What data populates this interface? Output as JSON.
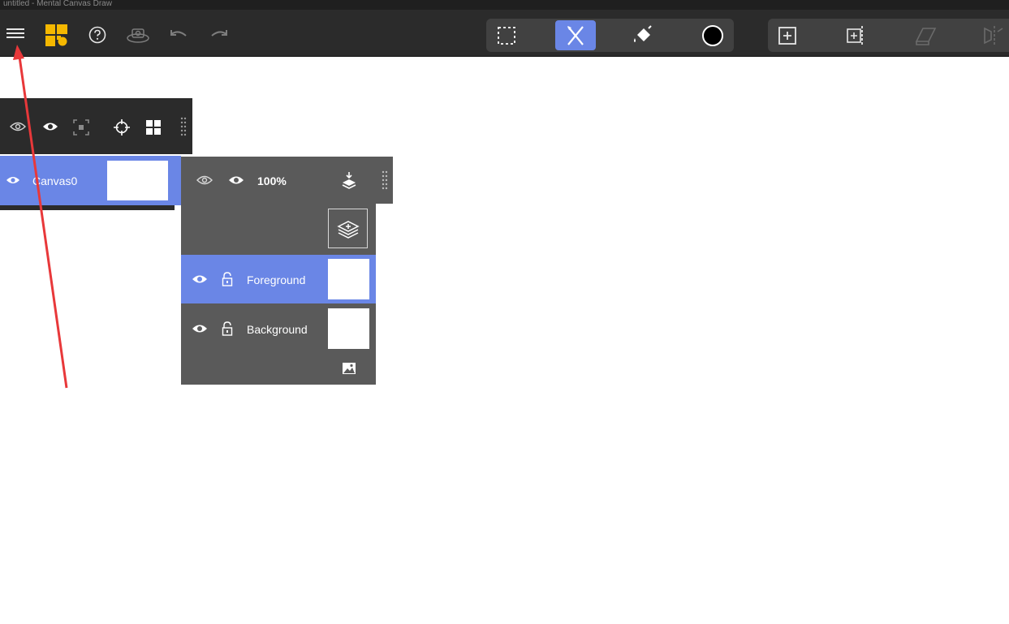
{
  "window": {
    "title": "untitled - Mental Canvas Draw"
  },
  "colors": {
    "toolbar_bg": "#2b2b2b",
    "group_bg": "#414141",
    "accent": "#6a86e6",
    "panel_bg": "#5a5a5a",
    "logo_yellow": "#f5b800",
    "annotation_red": "#e8383a",
    "current_color": "#000000"
  },
  "toolbar": {
    "left_icons": [
      "menu-icon",
      "app-logo-icon",
      "help-icon",
      "camera-view-icon",
      "undo-icon",
      "redo-icon"
    ],
    "tool_group": [
      "selection-tool-icon",
      "draw-tool-icon",
      "fill-bucket-icon",
      "color-swatch"
    ],
    "active_tool": "draw-tool-icon",
    "canvas_group": [
      "add-canvas-icon",
      "split-canvas-icon",
      "plane-icon",
      "mirror-icon"
    ]
  },
  "canvas_panel": {
    "header_icons": [
      "visibility-toggle-icon",
      "eye-icon",
      "focus-icon",
      "crosshair-icon",
      "grid-icon",
      "drag-handle-icon"
    ],
    "canvas": {
      "name": "Canvas0"
    }
  },
  "layer_panel": {
    "opacity": "100%",
    "header_icons": [
      "visibility-toggle-icon",
      "eye-icon",
      "merge-down-icon",
      "drag-handle-icon"
    ],
    "add_layer_icon": "add-layer-icon",
    "layers": [
      {
        "name": "Foreground",
        "selected": true
      },
      {
        "name": "Background",
        "selected": false
      }
    ],
    "image_icon": "image-icon"
  }
}
